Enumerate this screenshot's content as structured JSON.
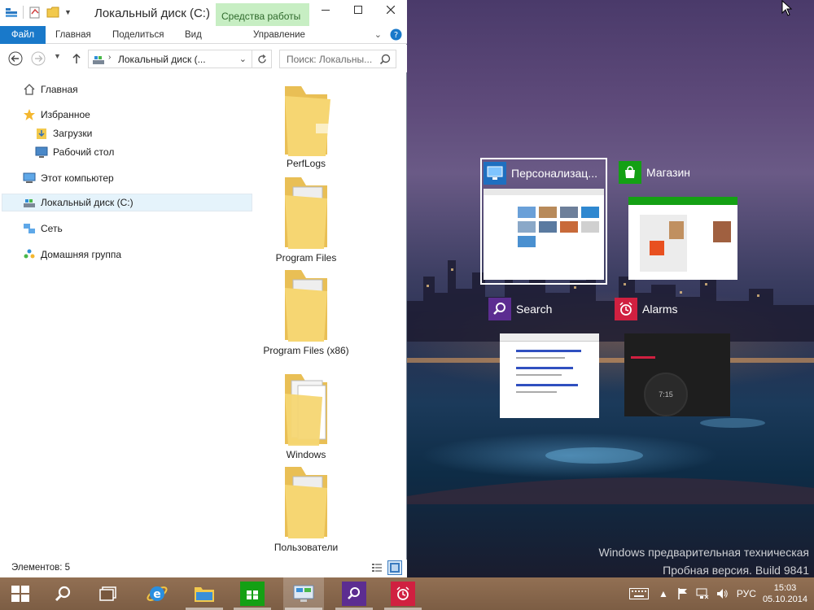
{
  "explorer": {
    "title": "Локальный диск (C:)",
    "contextual_tab": "Средства работы ...",
    "tabs": {
      "file": "Файл",
      "home": "Главная",
      "share": "Поделиться",
      "view": "Вид",
      "manage": "Управление"
    },
    "address": "Локальный диск (...",
    "search_placeholder": "Поиск: Локальны...",
    "nav": {
      "home": "Главная",
      "favorites": "Избранное",
      "downloads": "Загрузки",
      "desktop": "Рабочий стол",
      "this_pc": "Этот компьютер",
      "local_disk": "Локальный диск (C:)",
      "network": "Сеть",
      "homegroup": "Домашняя группа"
    },
    "folders": [
      "PerfLogs",
      "Program Files",
      "Program Files (x86)",
      "Windows",
      "Пользователи"
    ],
    "status": "Элементов: 5"
  },
  "task_view": {
    "items": [
      {
        "title": "Персонализац...",
        "icon": "personalization-icon",
        "color": "#1e6fc0"
      },
      {
        "title": "Магазин",
        "icon": "store-icon",
        "color": "#14a014"
      },
      {
        "title": "Search",
        "icon": "search-icon",
        "color": "#5c2d91"
      },
      {
        "title": "Alarms",
        "icon": "alarm-icon",
        "color": "#d02040"
      }
    ],
    "alarm_time": "7:15"
  },
  "watermark": {
    "line1": "Windows предварительная техническая",
    "line2": "Пробная версия. Build 9841"
  },
  "taskbar": {
    "language": "РУС",
    "time": "15:03",
    "date": "05.10.2014"
  },
  "colors": {
    "accent": "#1979ca",
    "contextual_tab_bg": "#c7eec3",
    "selected_bg": "#e5f3fb",
    "folder_yellow": "#f6d672"
  }
}
